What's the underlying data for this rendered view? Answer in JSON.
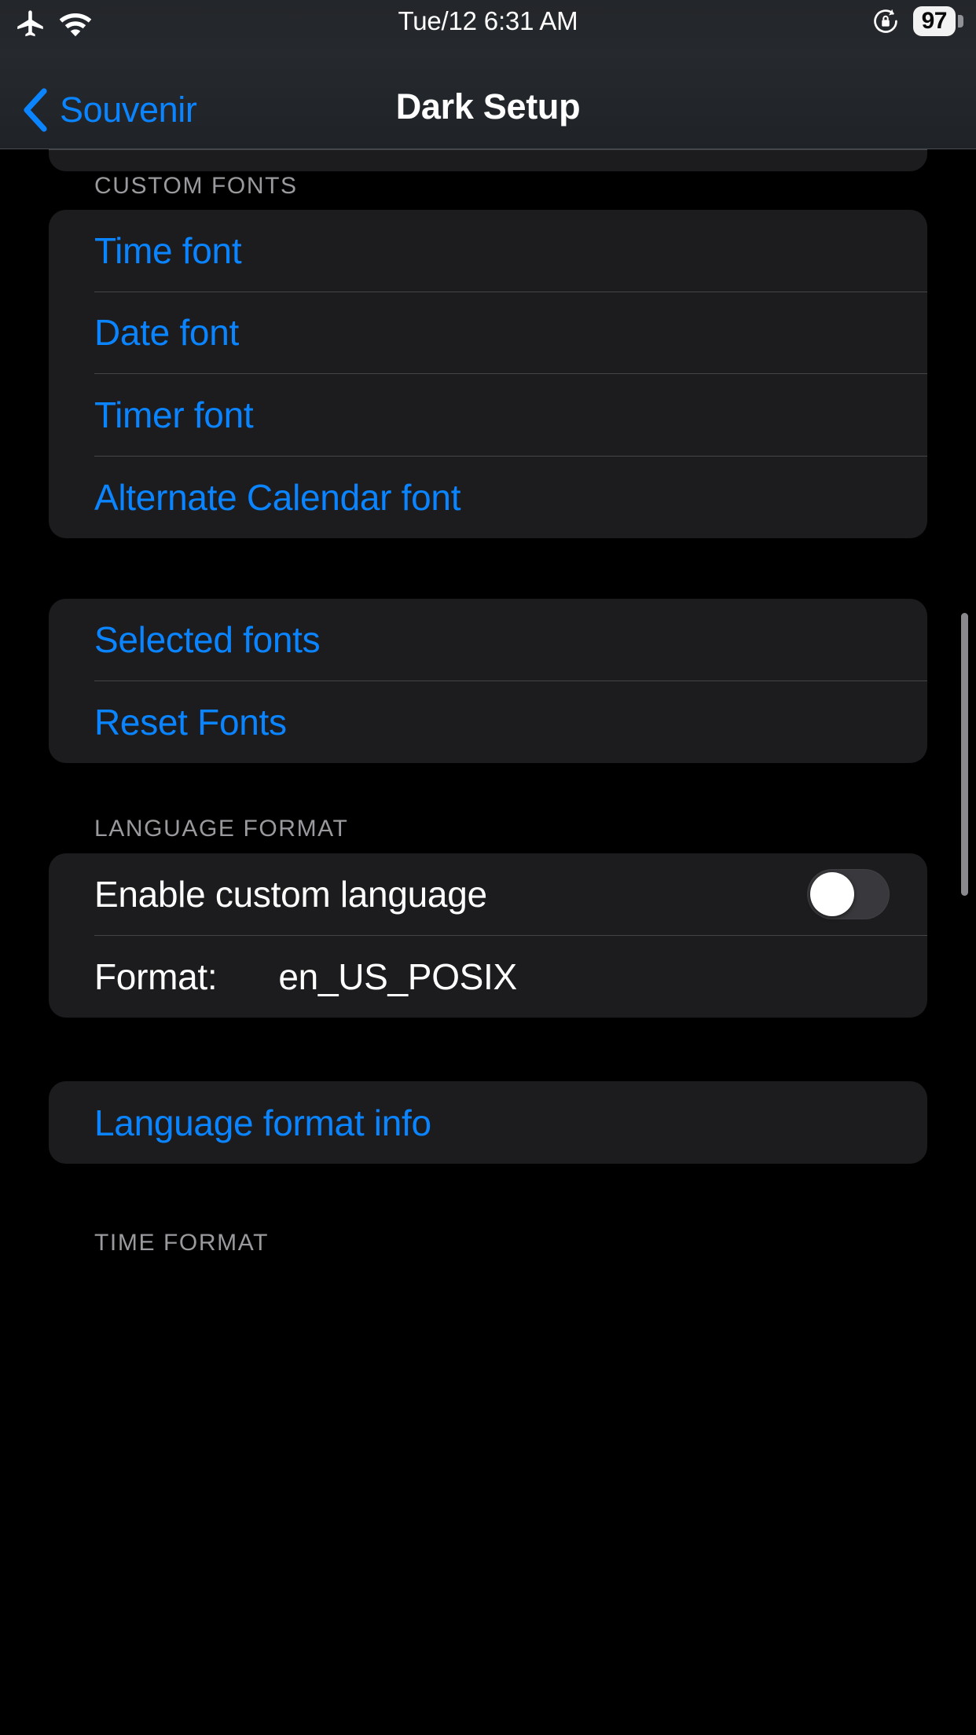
{
  "status_bar": {
    "airplane_icon": "airplane-icon",
    "wifi_icon": "wifi-icon",
    "datetime": "Tue/12 6:31 AM",
    "rotation_lock_icon": "rotation-lock-icon",
    "battery_percent": "97"
  },
  "nav": {
    "back_label": "Souvenir",
    "back_icon": "chevron-left-icon",
    "title": "Dark Setup"
  },
  "sections": {
    "custom_fonts": {
      "header": "CUSTOM FONTS",
      "rows": [
        {
          "label": "Time font"
        },
        {
          "label": "Date font"
        },
        {
          "label": "Timer font"
        },
        {
          "label": "Alternate Calendar font"
        }
      ]
    },
    "fonts_actions": {
      "rows": [
        {
          "label": "Selected fonts"
        },
        {
          "label": "Reset Fonts"
        }
      ]
    },
    "language_format": {
      "header": "LANGUAGE FORMAT",
      "toggle_row": {
        "label": "Enable custom language",
        "toggle_state": "off"
      },
      "format_row": {
        "label": "Format:",
        "value": "en_US_POSIX"
      }
    },
    "language_info": {
      "rows": [
        {
          "label": "Language format info"
        }
      ]
    },
    "time_format": {
      "header": "TIME FORMAT"
    }
  },
  "colors": {
    "accent_blue": "#0a84ff",
    "card_bg": "#1c1c1e",
    "page_bg": "#000000",
    "header_text": "#9a9a9e",
    "separator": "rgba(160,165,175,.30)",
    "toggle_track_off": "#39393d",
    "toggle_knob": "#ffffff",
    "scrollbar": "#8a8a8e"
  }
}
